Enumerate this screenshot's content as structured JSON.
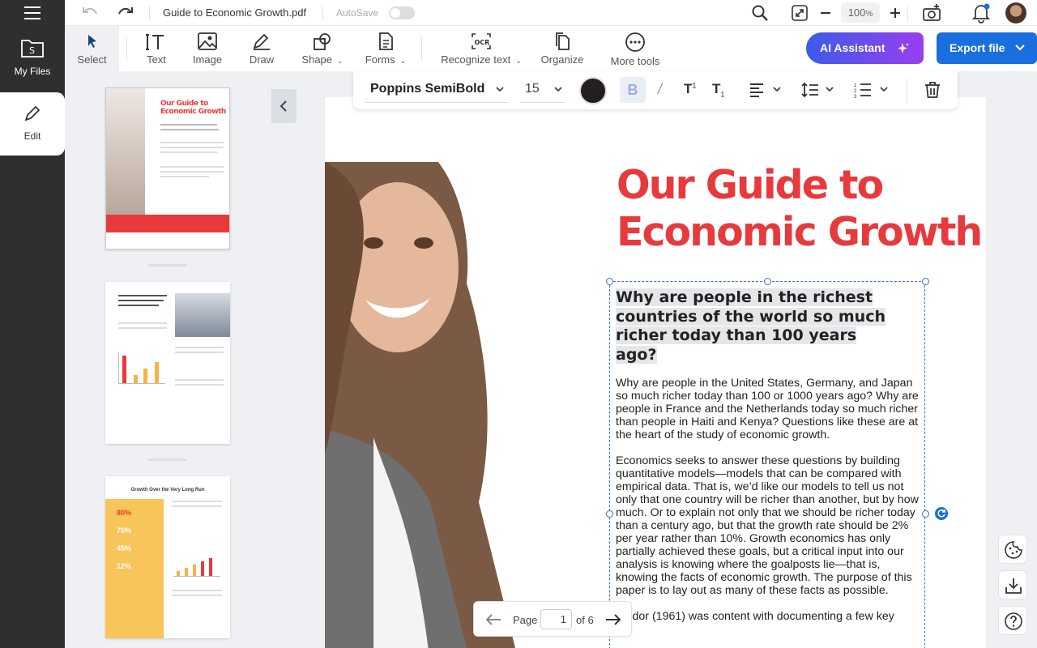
{
  "rail": {
    "my_files": "My Files",
    "edit": "Edit"
  },
  "topbar": {
    "file_name": "Guide to Economic Growth.pdf",
    "autosave_label": "AutoSave",
    "autosave_on": false,
    "zoom_value": "100",
    "zoom_unit": "%"
  },
  "toolbar": {
    "select": "Select",
    "text": "Text",
    "image": "Image",
    "draw": "Draw",
    "shape": "Shape",
    "forms": "Forms",
    "recognize_text": "Recognize text",
    "organize": "Organize",
    "more_tools": "More tools",
    "ai_assistant": "AI Assistant",
    "export": "Export file"
  },
  "format": {
    "font_name": "Poppins SemiBold",
    "font_size": "15",
    "text_color": "#231f20"
  },
  "document": {
    "title_line1": "Our Guide to",
    "title_line2": "Economic Growth",
    "heading_line1": "Why are people in the richest",
    "heading_line2": "countries of the world so much",
    "heading_line3": "richer today than 100 years ago?",
    "para1": "Why are people in the United States, Germany, and Japan so much richer today than 100 or 1000 years ago? Why are people in France and the Netherlands today so much richer than people in Haiti and Kenya? Questions like these are at the heart of the study of economic growth.",
    "para2": "Economics seeks to answer these questions by building quantitative models—models that can be compared with empirical data. That is, we’d like our models to tell us not only that one country will be richer than another, but by how much. Or to explain not only that we should be richer today than a century ago, but that the growth rate should be 2% per year rather than 10%. Growth economics has only partially achieved these goals, but a critical input into our analysis is knowing where the goalposts lie—that is, knowing the facts of economic growth. The purpose of this paper is to lay out as many of these facts as possible.",
    "para3": "Kaldor (1961) was content with documenting a few key"
  },
  "thumbnails": {
    "page1_title_line1": "Our Guide to",
    "page1_title_line2": "Economic Growth",
    "page3_title": "Growth Over the Very Long Run",
    "page3_stats": [
      "80%",
      "75%",
      "45%",
      "12%"
    ]
  },
  "pager": {
    "page_label": "Page",
    "current_page": "1",
    "of_label": "of 6"
  },
  "colors": {
    "accent_red": "#e8393d",
    "primary_blue": "#1a6fdf",
    "rail_dark": "#2f2f2f"
  }
}
